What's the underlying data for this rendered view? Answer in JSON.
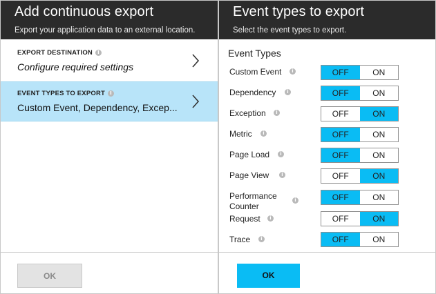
{
  "left_blade": {
    "title": "Add continuous export",
    "subtitle": "Export your application data to an external location.",
    "items": [
      {
        "label": "EXPORT DESTINATION",
        "value": "Configure required settings",
        "selected": false
      },
      {
        "label": "EVENT TYPES TO EXPORT",
        "value": "Custom Event, Dependency, Excep...",
        "selected": true
      }
    ],
    "ok_label": "OK",
    "ok_enabled": false
  },
  "right_blade": {
    "title": "Event types to export",
    "subtitle": "Select the event types to export.",
    "section_title": "Event Types",
    "off_label": "OFF",
    "on_label": "ON",
    "event_types": [
      {
        "label": "Custom Event",
        "state": "OFF"
      },
      {
        "label": "Dependency",
        "state": "OFF"
      },
      {
        "label": "Exception",
        "state": "ON"
      },
      {
        "label": "Metric",
        "state": "OFF"
      },
      {
        "label": "Page Load",
        "state": "OFF"
      },
      {
        "label": "Page View",
        "state": "ON"
      },
      {
        "label": "Performance Counter",
        "state": "OFF"
      },
      {
        "label": "Request",
        "state": "ON"
      },
      {
        "label": "Trace",
        "state": "OFF"
      }
    ],
    "ok_label": "OK"
  },
  "info_glyph": "i",
  "icons": {
    "info": "info-icon",
    "chevron": "chevron-right-icon"
  },
  "colors": {
    "header_bg": "#2b2b2b",
    "accent": "#0abcf4",
    "selected_item_bg": "#b8e4f9",
    "disabled_button_bg": "#e3e3e3"
  }
}
